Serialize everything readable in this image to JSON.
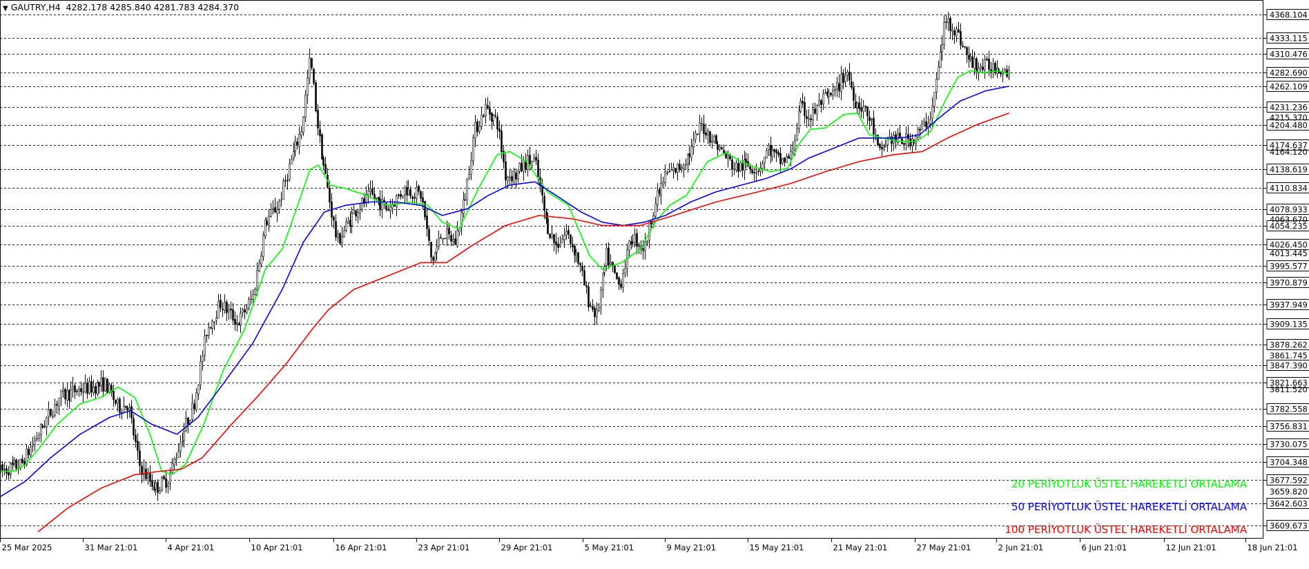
{
  "header": {
    "symbol": "GAUTRY,H4",
    "ohlc": "4282.178 4285.840 4281.783 4284.370"
  },
  "legend": {
    "ema20": "20 PERİYOTLUK ÜSTEL HAREKETLİ ORTALAMA",
    "ema50": "50 PERİYOTLUK ÜSTEL HAREKETLİ ORTALAMA",
    "ema100": "100 PERİYOTLUK ÜSTEL HAREKETLİ ORTALAMA"
  },
  "colors": {
    "ema20": "#00ff00",
    "ema50": "#0000ff",
    "ema100": "#ff0000",
    "candles": "#000000",
    "gridlines": "#000000",
    "background": "#ffffff"
  },
  "chart_data": {
    "type": "candlestick",
    "symbol": "GAUTRY",
    "timeframe": "H4",
    "grid": false,
    "ylim": [
      3590,
      4390
    ],
    "x_tick_labels": [
      "25 Mar 2025",
      "31 Mar 21:01",
      "4 Apr 21:01",
      "10 Apr 21:01",
      "16 Apr 21:01",
      "23 Apr 21:01",
      "29 Apr 21:01",
      "5 May 21:01",
      "9 May 21:01",
      "15 May 21:01",
      "21 May 21:01",
      "27 May 21:01",
      "2 Jun 21:01",
      "6 Jun 21:01",
      "12 Jun 21:01",
      "18 Jun 21:01"
    ],
    "price_levels_boxed": [
      "4368.104",
      "4333.115",
      "4310.476",
      "4282.690",
      "4262.109",
      "4231.236",
      "4204.480",
      "4174.637",
      "4138.619",
      "4110.834",
      "4078.933",
      "4054.235",
      "4026.450",
      "3995.577",
      "3970.879",
      "3937.949",
      "3909.135",
      "3878.262",
      "3847.390",
      "3821.663",
      "3782.558",
      "3756.831",
      "3730.075",
      "3704.348",
      "3677.592",
      "3642.603",
      "3609.673"
    ],
    "price_levels_plain": [
      "4215.370",
      "4164.120",
      "4063.670",
      "4013.445",
      "3861.745",
      "3811.520",
      "3659.820"
    ],
    "series": [
      {
        "name": "20 PERİYOTLUK ÜSTEL HAREKETLİ ORTALAMA",
        "color": "#00ff00",
        "x": [
          0,
          16,
          30,
          47,
          68,
          95,
          120,
          140,
          160,
          178,
          192,
          204,
          220,
          242,
          265,
          290,
          315,
          335,
          352,
          368,
          378,
          392,
          410,
          435,
          460,
          488,
          508,
          525,
          545,
          568,
          590,
          605,
          625,
          650,
          675,
          700,
          715,
          738,
          760,
          778,
          795,
          815,
          840,
          862,
          880,
          900,
          915,
          935,
          948,
          962,
          980,
          1002,
          1018,
          1032,
          1048,
          1068,
          1088,
          1105,
          1122,
          1137,
          1152,
          1168,
          1185,
          1198
        ],
        "y": [
          3690,
          3690,
          3700,
          3725,
          3760,
          3790,
          3800,
          3815,
          3800,
          3745,
          3690,
          3685,
          3700,
          3760,
          3840,
          3900,
          3990,
          4020,
          4080,
          4138,
          4145,
          4115,
          4110,
          4100,
          4085,
          4090,
          4085,
          4060,
          4050,
          4110,
          4160,
          4165,
          4150,
          4105,
          4085,
          4010,
          3990,
          4000,
          4020,
          4060,
          4085,
          4100,
          4150,
          4163,
          4150,
          4140,
          4135,
          4140,
          4175,
          4198,
          4200,
          4220,
          4222,
          4190,
          4185,
          4180,
          4180,
          4195,
          4240,
          4275,
          4285,
          4282,
          4285,
          4280
        ]
      },
      {
        "name": "50 PERİYOTLUK ÜSTEL HAREKETLİ ORTALAMA",
        "color": "#0000ff",
        "x": [
          0,
          30,
          60,
          95,
          130,
          155,
          180,
          210,
          235,
          265,
          300,
          335,
          360,
          385,
          410,
          440,
          470,
          500,
          525,
          555,
          580,
          605,
          635,
          660,
          690,
          715,
          740,
          765,
          790,
          820,
          850,
          880,
          910,
          940,
          960,
          990,
          1020,
          1045,
          1070,
          1092,
          1115,
          1140,
          1170,
          1198
        ],
        "y": [
          3652,
          3675,
          3710,
          3745,
          3770,
          3780,
          3760,
          3745,
          3770,
          3820,
          3880,
          3960,
          4030,
          4075,
          4085,
          4090,
          4090,
          4085,
          4070,
          4080,
          4100,
          4115,
          4120,
          4100,
          4075,
          4060,
          4055,
          4060,
          4070,
          4090,
          4105,
          4115,
          4125,
          4140,
          4155,
          4170,
          4185,
          4185,
          4185,
          4190,
          4215,
          4240,
          4255,
          4262
        ]
      },
      {
        "name": "100 PERİYOTLUK ÜSTEL HAREKETLİ ORTALAMA",
        "color": "#ff0000",
        "x": [
          45,
          80,
          120,
          160,
          190,
          215,
          240,
          275,
          305,
          340,
          370,
          390,
          420,
          460,
          500,
          530,
          560,
          600,
          640,
          680,
          715,
          760,
          800,
          850,
          900,
          940,
          980,
          1020,
          1060,
          1095,
          1125,
          1160,
          1198
        ],
        "y": [
          3600,
          3635,
          3665,
          3685,
          3690,
          3693,
          3710,
          3760,
          3800,
          3850,
          3900,
          3930,
          3960,
          3980,
          4000,
          4000,
          4025,
          4055,
          4070,
          4065,
          4055,
          4055,
          4070,
          4090,
          4105,
          4118,
          4135,
          4150,
          4160,
          4165,
          4185,
          4205,
          4222
        ]
      }
    ],
    "price_path": {
      "x": [
        0,
        25,
        45,
        70,
        90,
        110,
        125,
        140,
        152,
        165,
        175,
        185,
        200,
        215,
        230,
        245,
        262,
        282,
        300,
        315,
        330,
        345,
        358,
        368,
        378,
        390,
        400,
        420,
        440,
        460,
        480,
        500,
        512,
        525,
        540,
        552,
        563,
        576,
        590,
        600,
        612,
        625,
        635,
        648,
        660,
        672,
        685,
        698,
        708,
        720,
        735,
        750,
        765,
        775,
        790,
        805,
        820,
        832,
        848,
        860,
        872,
        885,
        900,
        912,
        925,
        938,
        950,
        962,
        975,
        990,
        1005,
        1015,
        1025,
        1035,
        1043,
        1055,
        1070,
        1085,
        1095,
        1105,
        1115,
        1122,
        1132,
        1140,
        1150,
        1162,
        1175,
        1188,
        1198
      ],
      "y": [
        3690,
        3700,
        3745,
        3800,
        3810,
        3815,
        3820,
        3785,
        3790,
        3700,
        3680,
        3665,
        3680,
        3740,
        3790,
        3900,
        3940,
        3910,
        3950,
        4060,
        4085,
        4150,
        4200,
        4305,
        4190,
        4100,
        4030,
        4075,
        4100,
        4080,
        4110,
        4100,
        4000,
        4045,
        4030,
        4100,
        4195,
        4230,
        4210,
        4130,
        4130,
        4150,
        4150,
        4060,
        4025,
        4045,
        4010,
        3945,
        3920,
        4010,
        3965,
        4040,
        4020,
        4080,
        4130,
        4140,
        4165,
        4205,
        4180,
        4160,
        4140,
        4145,
        4140,
        4170,
        4150,
        4155,
        4230,
        4215,
        4240,
        4250,
        4285,
        4240,
        4230,
        4205,
        4160,
        4185,
        4180,
        4185,
        4200,
        4220,
        4300,
        4360,
        4350,
        4330,
        4300,
        4290,
        4292,
        4290,
        4284
      ]
    }
  }
}
